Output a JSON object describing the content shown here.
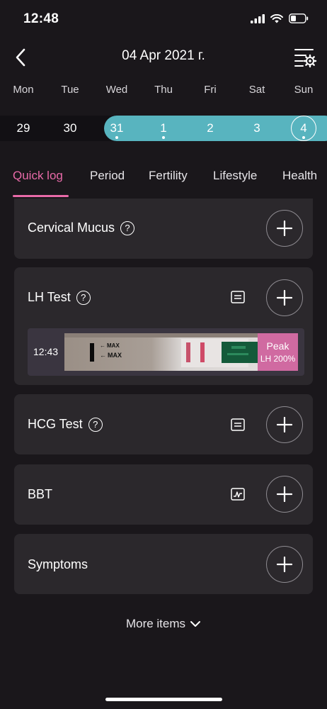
{
  "status_bar": {
    "time": "12:48"
  },
  "header": {
    "title": "04 Apr 2021 г."
  },
  "week": {
    "days": [
      "Mon",
      "Tue",
      "Wed",
      "Thu",
      "Fri",
      "Sat",
      "Sun"
    ],
    "dates": [
      "29",
      "30",
      "31",
      "1",
      "2",
      "3",
      "4"
    ],
    "selected_date": "4",
    "dotted_dates": [
      "31",
      "1",
      "4"
    ]
  },
  "tabs": [
    "Quick log",
    "Period",
    "Fertility",
    "Lifestyle",
    "Health"
  ],
  "active_tab": "Quick log",
  "cards": {
    "cervical": {
      "title": "Cervical Mucus"
    },
    "lh": {
      "title": "LH Test",
      "entry_time": "12:43",
      "peak_label": "Peak",
      "peak_value": "LH 200%"
    },
    "hcg": {
      "title": "HCG Test"
    },
    "bbt": {
      "title": "BBT"
    },
    "symptoms": {
      "title": "Symptoms"
    }
  },
  "strip_text": "MAX",
  "more_items": "More items",
  "colors": {
    "accent_pink": "#e86aa8",
    "teal": "#58b4bf",
    "card_bg": "#2b282c",
    "bg": "#1a171b"
  }
}
